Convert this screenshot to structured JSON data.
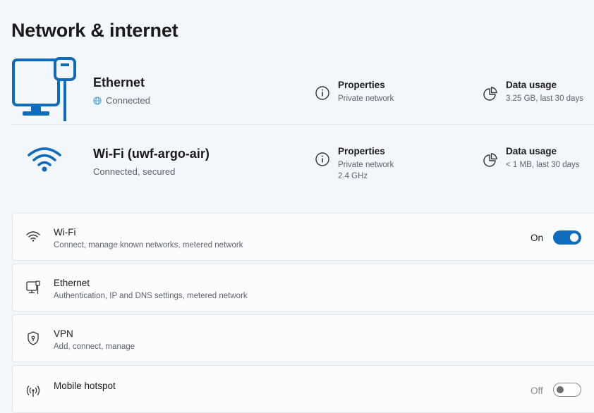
{
  "page": {
    "title": "Network & internet"
  },
  "connections": {
    "ethernet": {
      "name": "Ethernet",
      "status": "Connected",
      "properties": {
        "title": "Properties",
        "subtitle": "Private network"
      },
      "data_usage": {
        "title": "Data usage",
        "subtitle": "3.25 GB, last 30 days"
      }
    },
    "wifi": {
      "name": "Wi-Fi (uwf-argo-air)",
      "status": "Connected, secured",
      "properties": {
        "title": "Properties",
        "subtitle": "Private network",
        "subtitle2": "2.4 GHz"
      },
      "data_usage": {
        "title": "Data usage",
        "subtitle": "< 1 MB, last 30 days"
      }
    }
  },
  "settings": {
    "wifi": {
      "title": "Wi-Fi",
      "subtitle": "Connect, manage known networks, metered network",
      "toggle_label": "On",
      "toggle_on": true
    },
    "ethernet": {
      "title": "Ethernet",
      "subtitle": "Authentication, IP and DNS settings, metered network"
    },
    "vpn": {
      "title": "VPN",
      "subtitle": "Add, connect, manage"
    },
    "hotspot": {
      "title": "Mobile hotspot",
      "toggle_label": "Off",
      "toggle_on": false
    }
  },
  "colors": {
    "accent": "#0f6cbd",
    "background": "#f3f6fb",
    "card": "#fbfcfd"
  },
  "icons": [
    "ethernet-monitor-icon",
    "wifi-signal-icon",
    "info-icon",
    "pie-chart-icon",
    "globe-icon",
    "shield-icon",
    "hotspot-icon",
    "chevron-right-icon"
  ]
}
